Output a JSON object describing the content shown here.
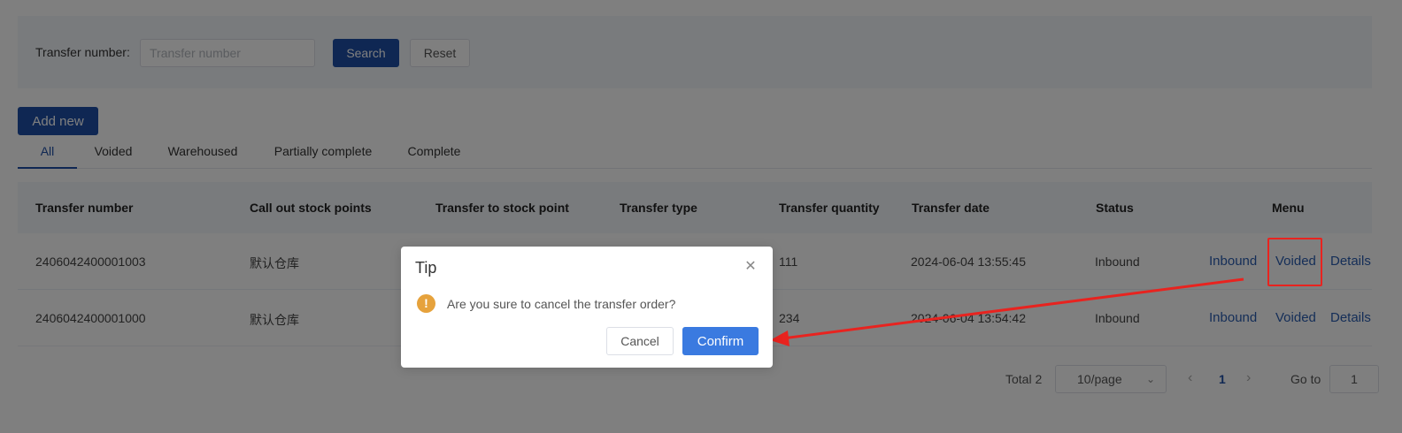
{
  "search": {
    "label": "Transfer number:",
    "placeholder": "Transfer number",
    "value": "",
    "search_label": "Search",
    "reset_label": "Reset"
  },
  "toolbar": {
    "add_label": "Add new"
  },
  "tabs": [
    {
      "label": "All",
      "active": true
    },
    {
      "label": "Voided",
      "active": false
    },
    {
      "label": "Warehoused",
      "active": false
    },
    {
      "label": "Partially complete",
      "active": false
    },
    {
      "label": "Complete",
      "active": false
    }
  ],
  "table": {
    "columns": [
      "Transfer number",
      "Call out stock points",
      "Transfer to stock point",
      "Transfer type",
      "Transfer quantity",
      "Transfer date",
      "Status",
      "Menu"
    ],
    "rows": [
      {
        "number": "2406042400001003",
        "call_out": "默认仓库",
        "transfer_to": "",
        "type": "",
        "quantity": "111",
        "date": "2024-06-04 13:55:45",
        "status": "Inbound",
        "actions": [
          "Inbound",
          "Voided",
          "Details"
        ]
      },
      {
        "number": "2406042400001000",
        "call_out": "默认仓库",
        "transfer_to": "",
        "type": "",
        "quantity": "234",
        "date": "2024-06-04 13:54:42",
        "status": "Inbound",
        "actions": [
          "Inbound",
          "Voided",
          "Details"
        ]
      }
    ]
  },
  "pagination": {
    "total": "Total 2",
    "page_size": "10/page",
    "current_page": "1",
    "goto_label": "Go to",
    "goto_value": "1"
  },
  "dialog": {
    "title": "Tip",
    "message": "Are you sure to cancel the transfer order?",
    "icon_glyph": "!",
    "cancel_label": "Cancel",
    "confirm_label": "Confirm"
  },
  "colors": {
    "primary": "#1e4fa6",
    "confirm": "#3a7ae0",
    "warning": "#e6a23c",
    "annotation": "#e8231f"
  }
}
